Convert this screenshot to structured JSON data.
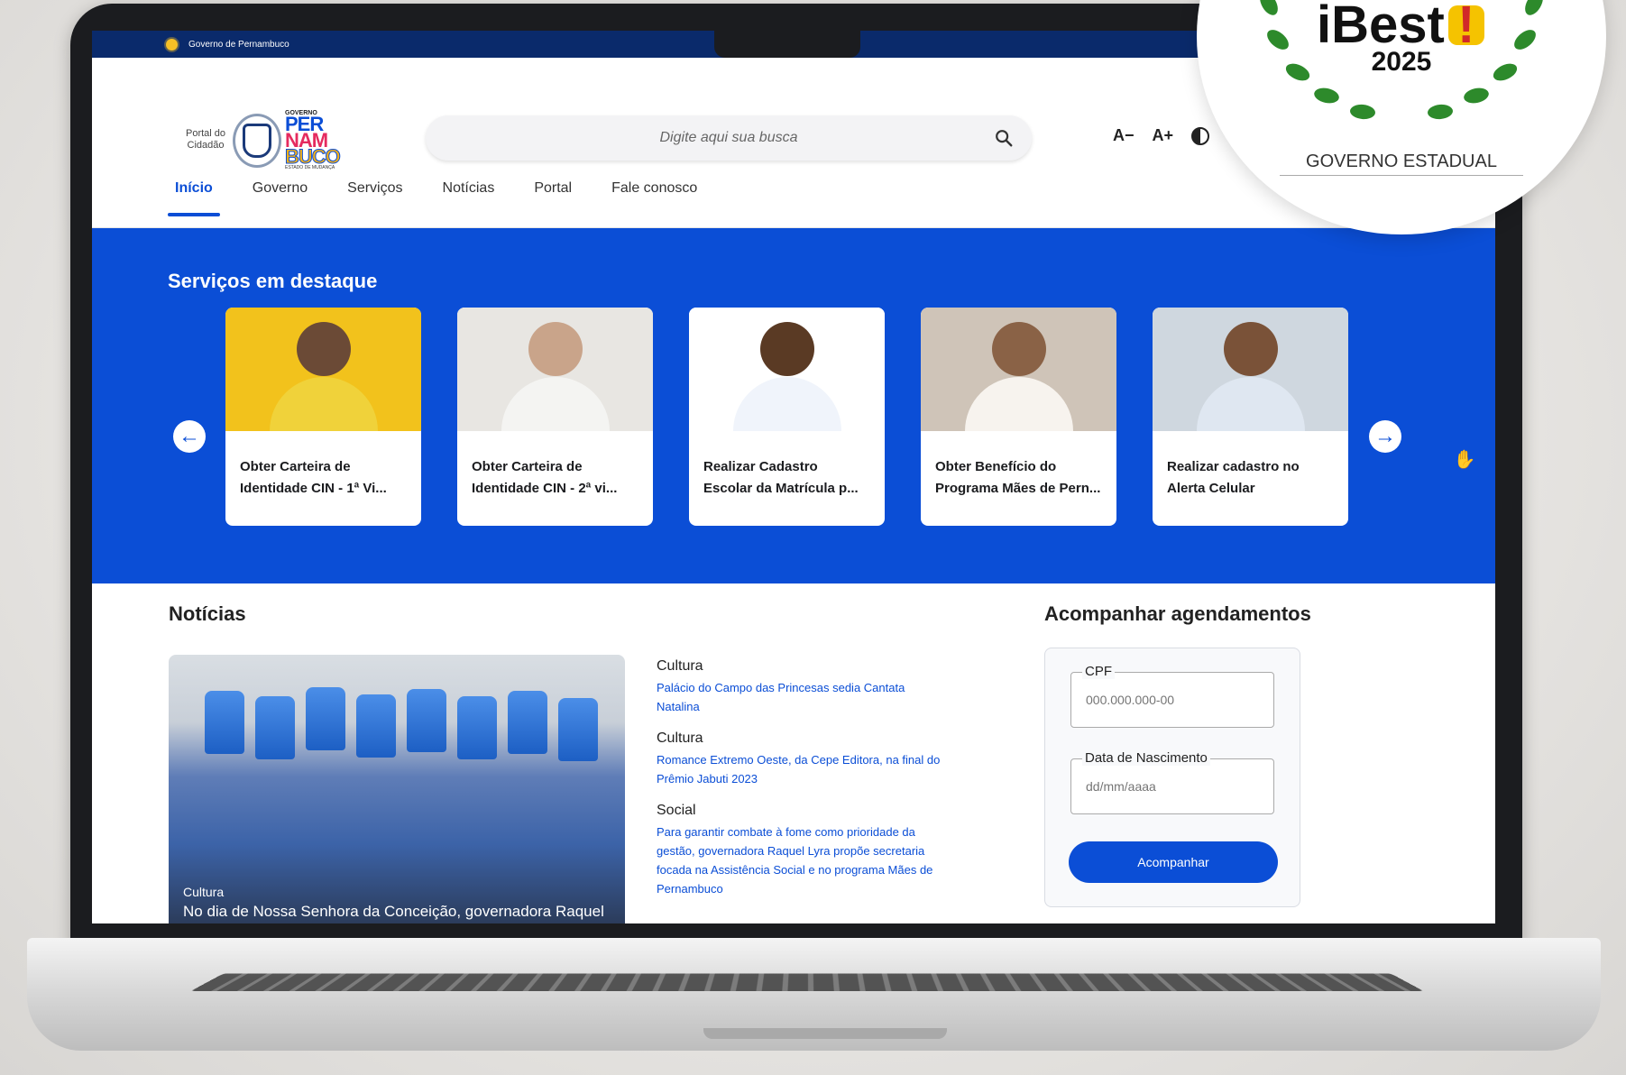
{
  "gov_bar": {
    "label": "Governo de Pernambuco"
  },
  "header": {
    "portal_label": "Portal do Cidadão",
    "logo": {
      "small": "GOVERNO",
      "line1": "PER",
      "line2": "NAM",
      "line3": "BUCO",
      "tag": "ESTADO DE MUDANÇA"
    },
    "search_placeholder": "Digite aqui sua busca",
    "font_decrease": "A−",
    "font_increase": "A+"
  },
  "nav": {
    "items": [
      "Início",
      "Governo",
      "Serviços",
      "Notícias",
      "Portal",
      "Fale conosco"
    ],
    "active": "Início"
  },
  "featured": {
    "title": "Serviços em destaque",
    "cards": [
      {
        "label": "Obter Carteira de Identidade CIN - 1ª Vi...",
        "bg": "#f2c21c",
        "body": "#f0d23a"
      },
      {
        "label": "Obter Carteira de Identidade CIN - 2ª vi...",
        "bg": "#e8e6e2",
        "body": "#f4f4f2"
      },
      {
        "label": "Realizar Cadastro Escolar da Matrícula p...",
        "bg": "#ffffff",
        "body": "#f0f4fb"
      },
      {
        "label": "Obter Benefício do Programa Mães de Pern...",
        "bg": "#cfc4b8",
        "body": "#f7f3ee"
      },
      {
        "label": "Realizar cadastro no Alerta Celular",
        "bg": "#cfd7df",
        "body": "#dfe7f1"
      }
    ]
  },
  "news": {
    "title": "Notícias",
    "main": {
      "category": "Cultura",
      "caption": "No dia de Nossa Senhora da Conceição, governadora Raquel"
    },
    "items": [
      {
        "category": "Cultura",
        "title": "Palácio do Campo das Princesas sedia Cantata Natalina"
      },
      {
        "category": "Cultura",
        "title": "Romance Extremo Oeste, da Cepe Editora, na final do Prêmio Jabuti 2023"
      },
      {
        "category": "Social",
        "title": "Para garantir combate à fome como prioridade da gestão, governadora Raquel Lyra propõe secretaria focada na Assistência Social e no programa Mães de Pernambuco"
      }
    ]
  },
  "tracking": {
    "title": "Acompanhar agendamentos",
    "cpf_label": "CPF",
    "cpf_placeholder": "000.000.000-00",
    "birth_label": "Data de Nascimento",
    "birth_placeholder": "dd/mm/aaaa",
    "button": "Acompanhar"
  },
  "award": {
    "brand": "iBest",
    "mark": "!",
    "year": "2025",
    "category": "GOVERNO ESTADUAL"
  },
  "colors": {
    "primary": "#0b4ed6",
    "gov_bar": "#0a2a6b"
  }
}
